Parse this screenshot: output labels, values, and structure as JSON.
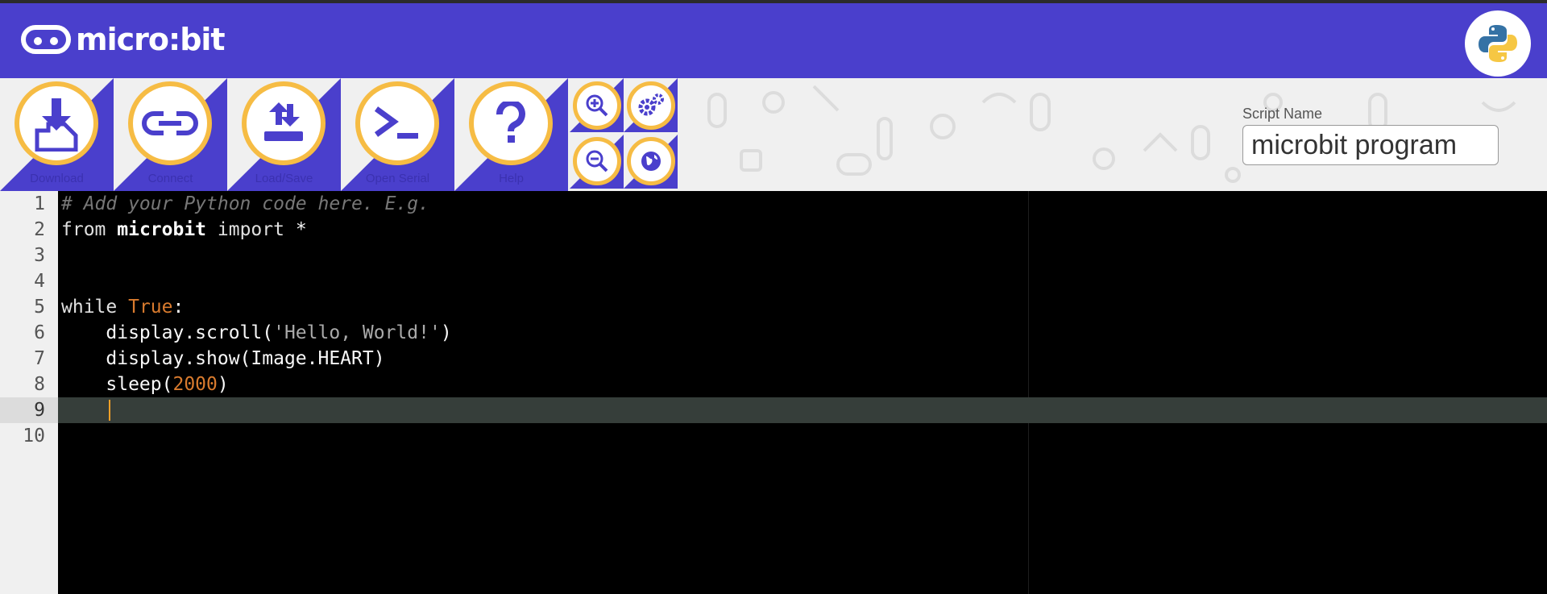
{
  "header": {
    "logo_text": "micro:bit",
    "python_button": "python-logo-icon"
  },
  "toolbar": {
    "buttons": [
      {
        "label": "Download",
        "icon": "download-icon"
      },
      {
        "label": "Connect",
        "icon": "connect-icon"
      },
      {
        "label": "Load/Save",
        "icon": "load-save-icon"
      },
      {
        "label": "Open Serial",
        "icon": "terminal-icon"
      },
      {
        "label": "Help",
        "icon": "help-icon"
      }
    ],
    "mini_buttons": [
      "zoom-in-icon",
      "zoom-out-icon",
      "settings-icon",
      "language-globe-icon"
    ],
    "script_name_label": "Script Name",
    "script_name_value": "microbit program"
  },
  "editor": {
    "line_numbers": [
      "1",
      "2",
      "3",
      "4",
      "5",
      "6",
      "7",
      "8",
      "9",
      "10"
    ],
    "active_line": 9,
    "lines": {
      "l1": "# Add your Python code here. E.g.",
      "l2_kw1": "from",
      "l2_mod": "microbit",
      "l2_kw2": "import",
      "l2_star": "*",
      "l5_kw": "while",
      "l5_const": "True",
      "l5_colon": ":",
      "l6_pre": "    display.scroll(",
      "l6_str": "'Hello, World!'",
      "l6_post": ")",
      "l7": "    display.show(Image.HEART)",
      "l8_pre": "    sleep(",
      "l8_num": "2000",
      "l8_post": ")"
    }
  },
  "colors": {
    "brand": "#4a3fcc",
    "accent": "#f6bc44",
    "editor_bg": "#000000"
  }
}
